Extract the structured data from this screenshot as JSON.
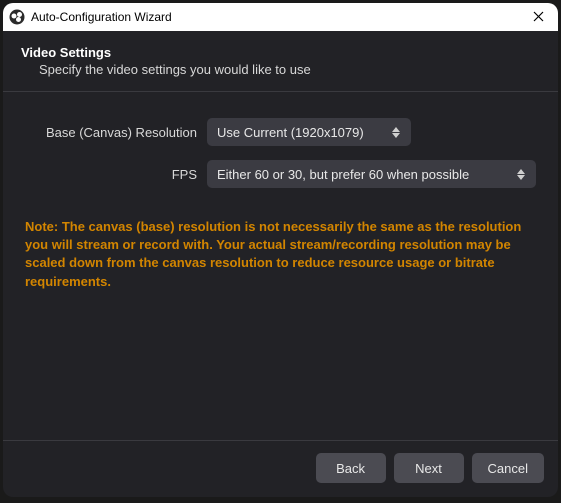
{
  "titlebar": {
    "title": "Auto-Configuration Wizard"
  },
  "header": {
    "title": "Video Settings",
    "subtitle": "Specify the video settings you would like to use"
  },
  "form": {
    "resolution": {
      "label": "Base (Canvas) Resolution",
      "value": "Use Current (1920x1079)"
    },
    "fps": {
      "label": "FPS",
      "value": "Either 60 or 30, but prefer 60 when possible"
    }
  },
  "note": "Note: The canvas (base) resolution is not necessarily the same as the resolution you will stream or record with. Your actual stream/recording resolution may be scaled down from the canvas resolution to reduce resource usage or bitrate requirements.",
  "footer": {
    "back": "Back",
    "next": "Next",
    "cancel": "Cancel"
  },
  "colors": {
    "note": "#d28500",
    "bg": "#222226",
    "control": "#3b3b42",
    "button": "#4b4b52"
  }
}
